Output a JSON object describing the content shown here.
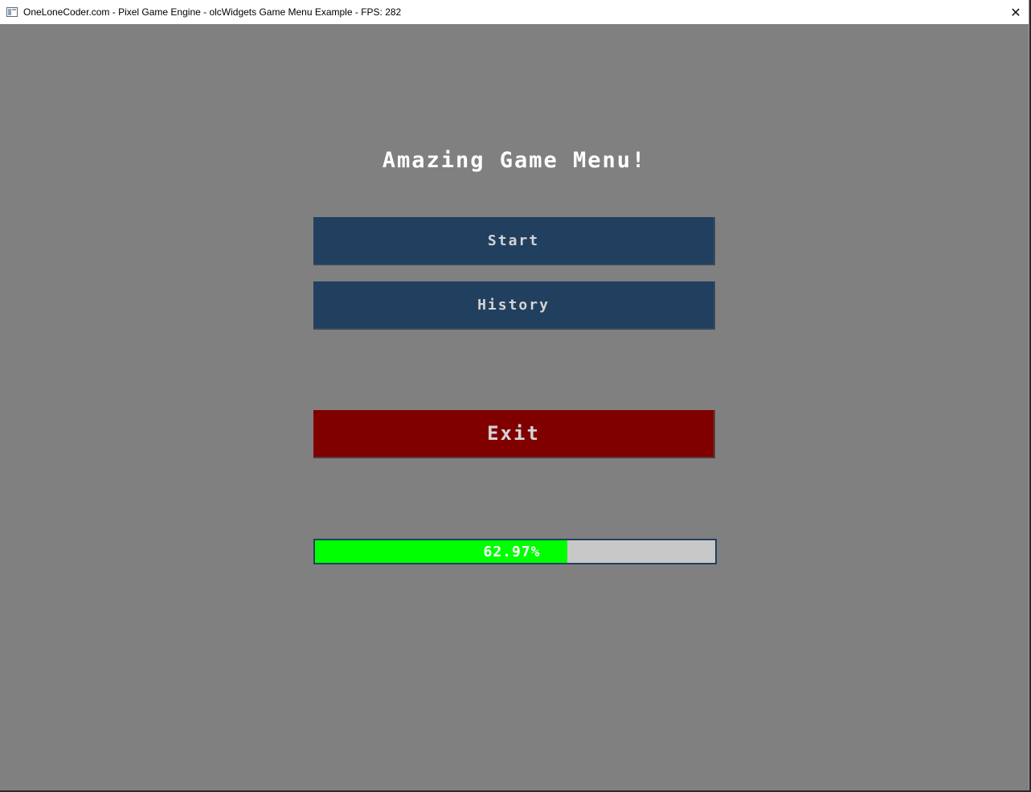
{
  "window": {
    "title": "OneLoneCoder.com - Pixel Game Engine - olcWidgets Game Menu Example - FPS: 282",
    "close_glyph": "✕",
    "icon": "app-window-icon"
  },
  "menu": {
    "title": "Amazing Game Menu!",
    "buttons": [
      {
        "label": "Start",
        "color": "#21405f"
      },
      {
        "label": "History",
        "color": "#21405f"
      },
      {
        "label": "Exit",
        "color": "#800000"
      }
    ]
  },
  "progress": {
    "label": "62.97%",
    "fraction": 0.6297,
    "fill_color": "#00ff00",
    "track_color": "#c8c8c8"
  },
  "colors": {
    "background": "#808080",
    "button_blue": "#21405f",
    "button_red": "#800000"
  }
}
